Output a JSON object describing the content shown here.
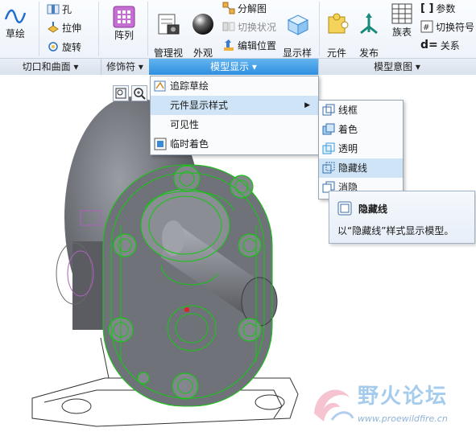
{
  "ribbon": {
    "sketch_label": "草绘",
    "hole_label": "孔",
    "extrude_label": "拉伸",
    "revolve_label": "旋转",
    "pattern_label": "阵列",
    "manage_views_label": "管理视\n图",
    "appearance_gallery_label": "外观\n库",
    "exploded_view_label": "分解图",
    "toggle_status_label": "切换状况",
    "edit_position_label": "编辑位置",
    "display_style_label": "显示样\n式",
    "component_interface_label": "元件\n界面",
    "publish_geometry_label": "发布\n几何",
    "family_table_label": "族表",
    "parameters_label": "参数",
    "switch_symbols_label": "切换符号",
    "relations_label": "关系"
  },
  "groups": {
    "cuts_surfaces": "切口和曲面",
    "modifiers": "修饰符",
    "model_display": "模型显示",
    "model_intent": "模型意图"
  },
  "model_display_menu": {
    "items": [
      "追踪草绘",
      "元件显示样式",
      "可见性",
      "临时着色"
    ]
  },
  "display_style_submenu": {
    "items": [
      "线框",
      "着色",
      "透明",
      "隐藏线",
      "消隐"
    ]
  },
  "tooltip": {
    "title": "隐藏线",
    "description": "以“隐藏线”样式显示模型。"
  },
  "watermark": {
    "title": "野火论坛",
    "url": "www.proewildfire.cn"
  },
  "colors": {
    "accent": "#2f8fe0",
    "model_edges": "#19c419",
    "model_body": "#7c7f86"
  }
}
